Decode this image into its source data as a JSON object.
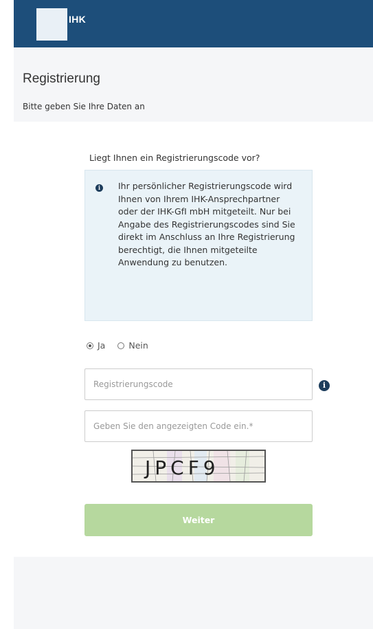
{
  "header": {
    "logo_text": "IHK"
  },
  "page": {
    "title": "Registrierung",
    "subtitle": "Bitte geben Sie Ihre Daten an"
  },
  "form": {
    "question": "Liegt Ihnen ein Registrierungscode vor?",
    "info_text": "Ihr persönlicher Registrierungscode wird Ihnen von Ihrem IHK-Ansprechpartner oder der IHK-GfI mbH mitgeteilt. Nur bei Angabe des Registrierungscodes sind Sie direkt im Anschluss an Ihre Registrierung berechtigt, die Ihnen mitgeteilte Anwendung zu benutzen.",
    "radio_yes": "Ja",
    "radio_no": "Nein",
    "selected": "Ja",
    "code_placeholder": "Registrierungscode",
    "captcha_placeholder": "Geben Sie den angezeigten Code ein.*",
    "captcha_text": "JPCF9",
    "continue_label": "Weiter"
  },
  "colors": {
    "header_blue": "#1d4e7a",
    "info_panel": "#eaf3f8",
    "button_green_disabled": "#b6d89e"
  },
  "icons": {
    "info": "info-circle-icon"
  }
}
